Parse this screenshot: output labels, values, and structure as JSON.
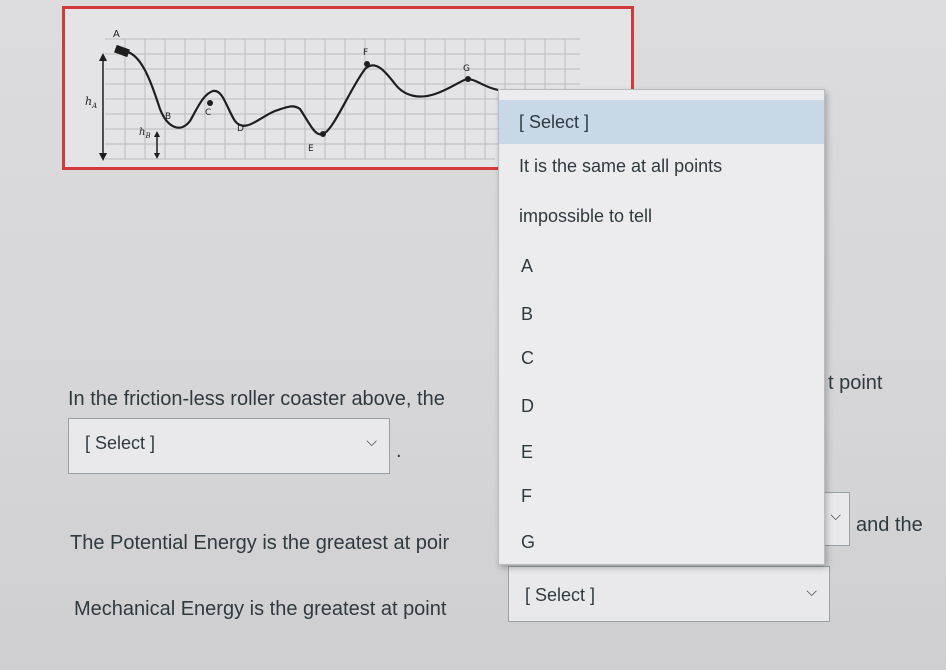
{
  "figure": {
    "labels": {
      "A": "A",
      "B": "B",
      "C": "C",
      "D": "D",
      "E": "E",
      "F": "F",
      "G": "G"
    },
    "height_labels": {
      "hA": "h",
      "hA_sub": "A",
      "hB": "h",
      "hB_sub": "B"
    }
  },
  "questions": {
    "q1_text": "In the friction-less roller coaster above, the",
    "q1_tail": "t point",
    "q1_select": "[ Select ]",
    "q1_period": ".",
    "q2_text": "The Potential Energy is the greatest at poir",
    "q2_tail": "and the",
    "q3_text": "Mechanical Energy is the greatest at point",
    "q3_select": "[ Select ]"
  },
  "dropdown": {
    "options": [
      "[ Select ]",
      "It is the same at all points",
      "impossible to tell",
      "A",
      "B",
      "C",
      "D",
      "E",
      "F",
      "G"
    ],
    "selected_index": 0
  },
  "chevron_icon": "chevron-down-icon"
}
